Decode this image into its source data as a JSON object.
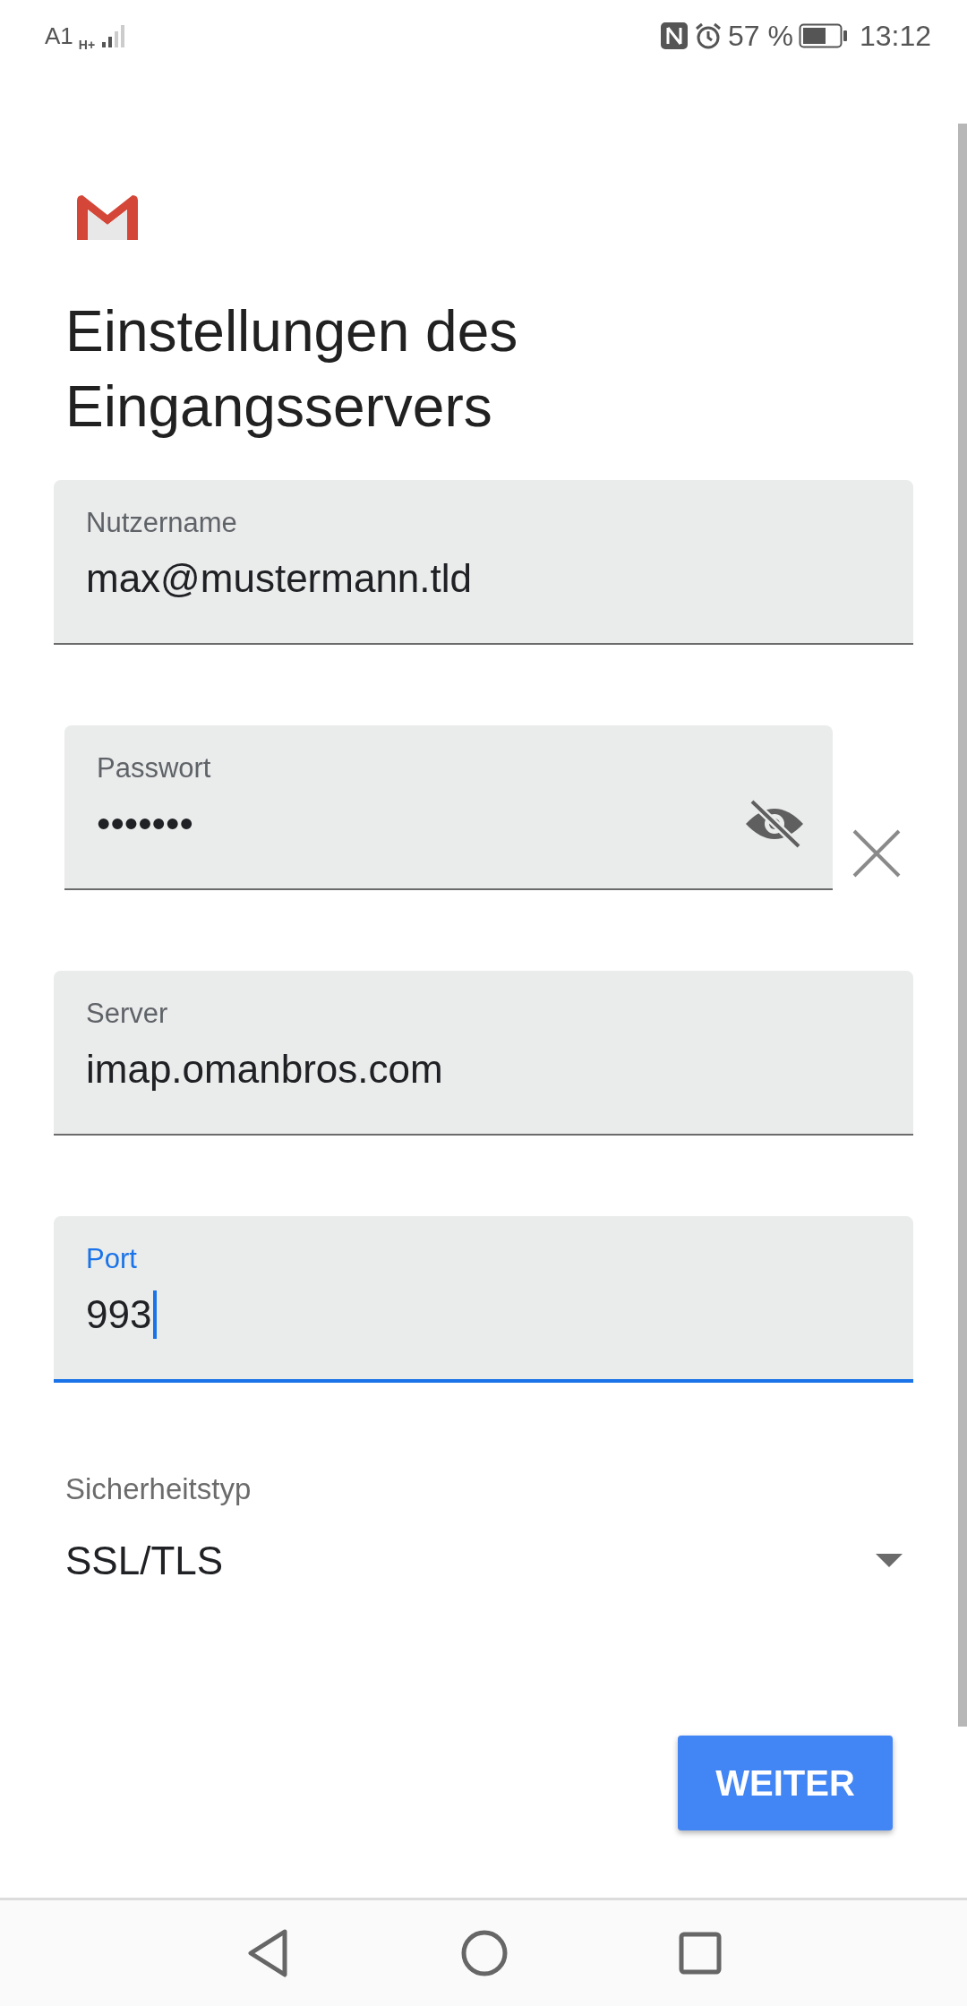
{
  "status_bar": {
    "carrier": "A1",
    "network": "H+",
    "battery": "57 %",
    "time": "13:12"
  },
  "title": "Einstellungen des Eingangsservers",
  "fields": [
    {
      "kind": "text",
      "label": "Nutzername",
      "value": "max@mustermann.tld",
      "focused": false
    },
    {
      "kind": "password",
      "label": "Passwort",
      "value": "•••••••",
      "focused": false,
      "masked": true
    },
    {
      "kind": "text",
      "label": "Server",
      "value": "imap.omanbros.com",
      "focused": false
    },
    {
      "kind": "text",
      "label": "Port",
      "value": "993",
      "focused": true
    }
  ],
  "security": {
    "label": "Sicherheitstyp",
    "value": "SSL/TLS"
  },
  "button": "WEITER"
}
